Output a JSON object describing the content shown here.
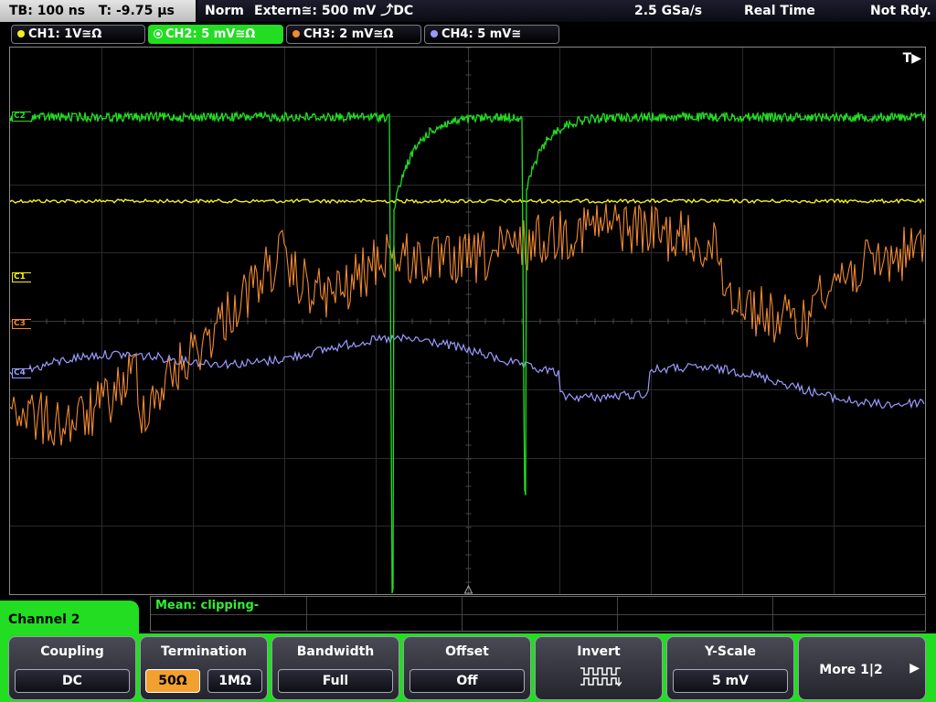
{
  "status_bar": {
    "timebase": "TB: 100 ns   T: -9.75 µs",
    "mode": "Norm",
    "trigger": "Extern≅: 500 mV ⤴DC",
    "sample_rate": "2.5 GSa/s",
    "acq": "Real Time",
    "state": "Not Rdy."
  },
  "channels": [
    {
      "label": "CH1: 1V≅Ω",
      "color": "#f4f020"
    },
    {
      "label": "CH2: 5 mV≅Ω",
      "color": "#22dd22",
      "active": true
    },
    {
      "label": "CH3: 2 mV≅Ω",
      "color": "#f08a30"
    },
    {
      "label": "CH4: 5 mV≅",
      "color": "#9a9aff"
    }
  ],
  "plot": {
    "trigger_marker": "T▶",
    "markers": [
      {
        "label": "C2",
        "color": "#22dd22"
      },
      {
        "label": "C1",
        "color": "#f4f020"
      },
      {
        "label": "C3",
        "color": "#f08a30"
      },
      {
        "label": "C4",
        "color": "#9a9aff"
      }
    ]
  },
  "measurement": {
    "label": "Mean: clipping-"
  },
  "menu": {
    "title": "Channel 2",
    "keys": {
      "coupling": {
        "title": "Coupling",
        "value": "DC"
      },
      "termination": {
        "title": "Termination",
        "opt1": "50Ω",
        "opt2": "1MΩ"
      },
      "bandwidth": {
        "title": "Bandwidth",
        "value": "Full"
      },
      "offset": {
        "title": "Offset",
        "value": "Off"
      },
      "invert": {
        "title": "Invert",
        "icon": "invert-waveform-icon"
      },
      "yscale": {
        "title": "Y-Scale",
        "value": "5 mV"
      },
      "more": {
        "title": "More 1|2",
        "icon": "play-arrow-icon"
      }
    }
  }
}
